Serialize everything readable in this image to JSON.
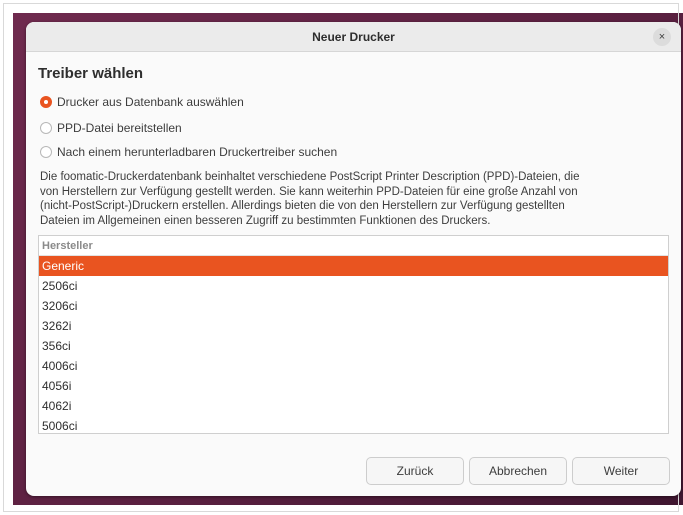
{
  "window": {
    "title": "Neuer Drucker",
    "close_glyph": "×"
  },
  "section_title": "Treiber wählen",
  "options": [
    {
      "label": "Drucker aus Datenbank auswählen",
      "checked": true
    },
    {
      "label": "PPD-Datei bereitstellen",
      "checked": false
    },
    {
      "label": "Nach einem herunterladbaren Druckertreiber suchen",
      "checked": false
    }
  ],
  "description": [
    "Die foomatic-Druckerdatenbank beinhaltet verschiedene PostScript Printer Description (PPD)-Dateien, die",
    "von Herstellern zur Verfügung gestellt werden. Sie kann weiterhin PPD-Dateien für eine große Anzahl von",
    "(nicht-PostScript-)Druckern erstellen. Allerdings bieten die von den Herstellern zur Verfügung gestellten",
    "Dateien im Allgemeinen einen besseren Zugriff zu bestimmten Funktionen des Druckers."
  ],
  "manufacturer_list": {
    "header": "Hersteller",
    "items": [
      "Generic",
      "2506ci",
      "3206ci",
      "3262i",
      "356ci",
      "4006ci",
      "4056i",
      "4062i",
      "5006ci"
    ],
    "selected_index": 0
  },
  "buttons": {
    "back": "Zurück",
    "cancel": "Abbrechen",
    "next": "Weiter"
  },
  "colors": {
    "accent": "#e95420",
    "backdrop": "#5a2040"
  }
}
